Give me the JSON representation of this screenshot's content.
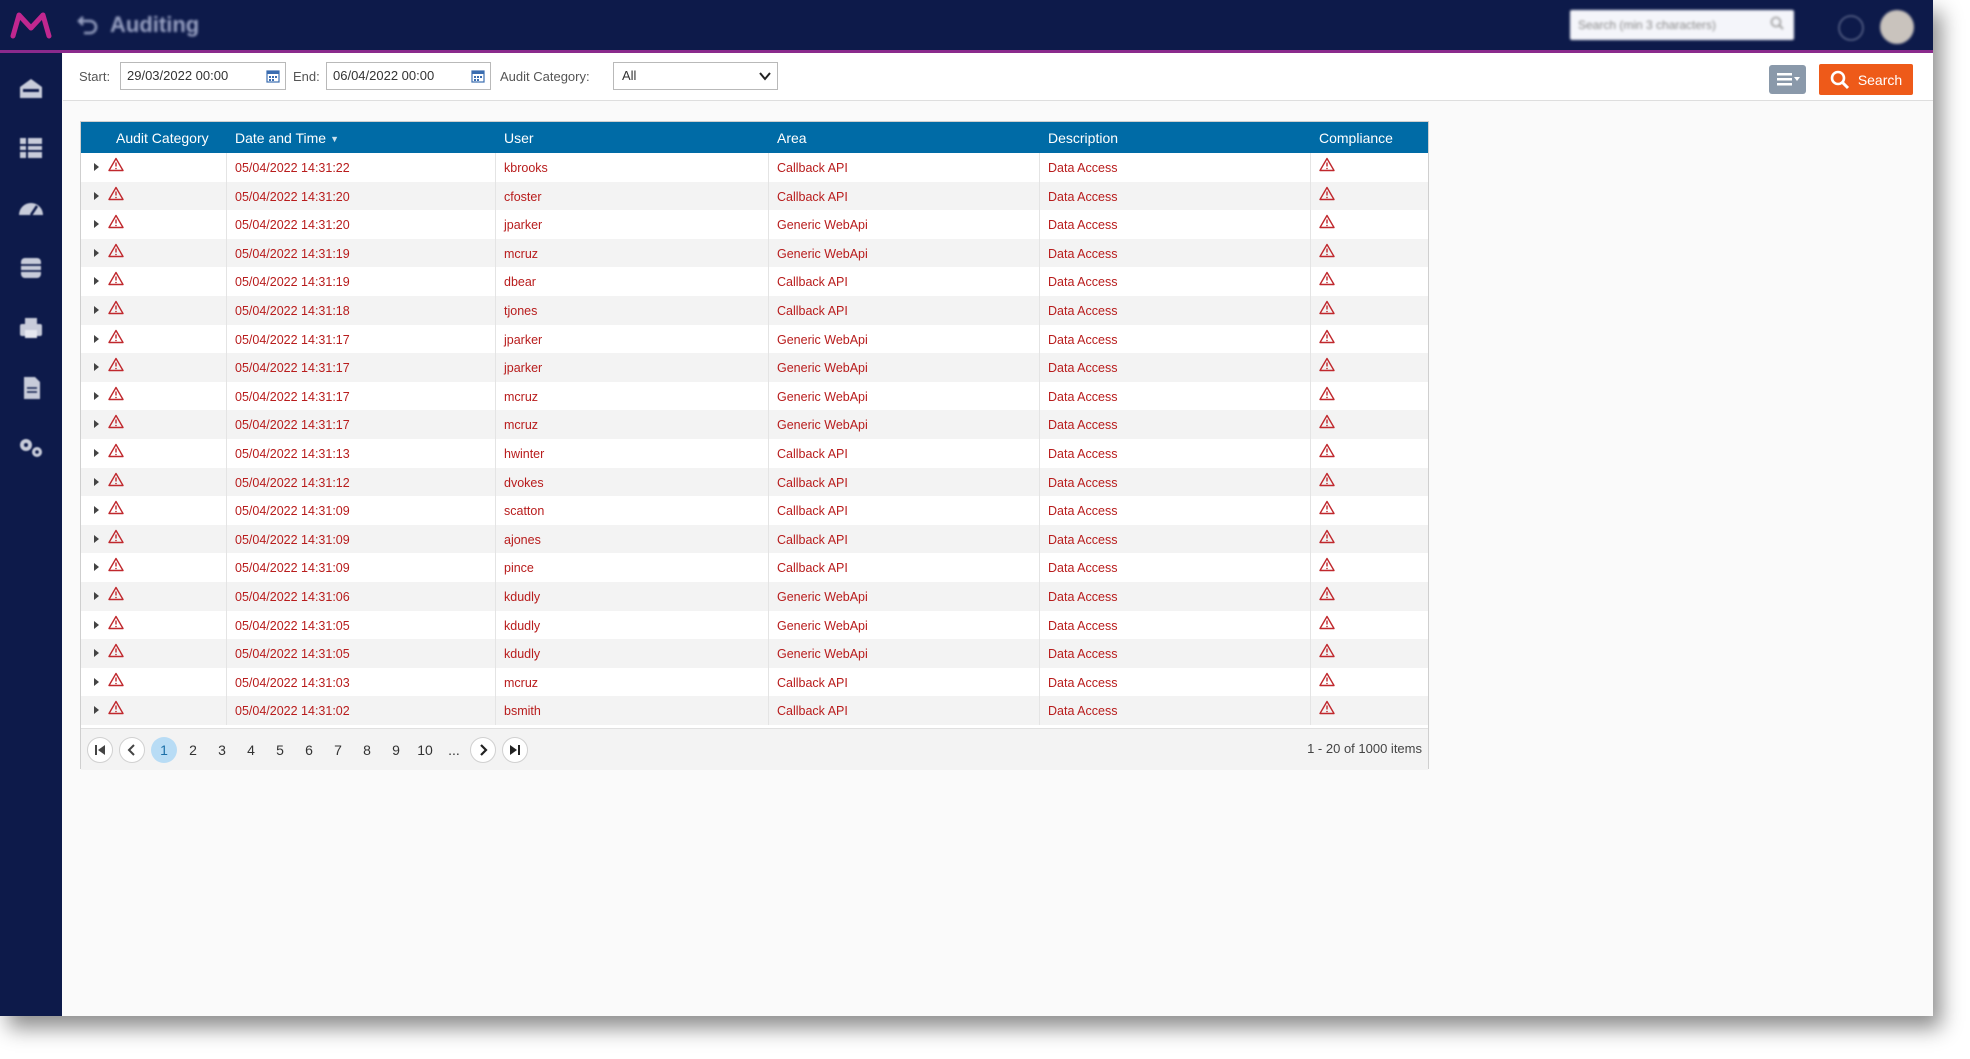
{
  "header": {
    "title": "Auditing",
    "global_search_placeholder": "Search (min 3 characters)"
  },
  "sidebar": {
    "items": [
      {
        "icon": "home-icon"
      },
      {
        "icon": "list-icon"
      },
      {
        "icon": "dashboard-icon"
      },
      {
        "icon": "database-icon"
      },
      {
        "icon": "printer-icon"
      },
      {
        "icon": "document-icon"
      },
      {
        "icon": "settings-icon"
      }
    ]
  },
  "filters": {
    "start_label": "Start:",
    "start_value": "29/03/2022 00:00",
    "end_label": "End:",
    "end_value": "06/04/2022 00:00",
    "category_label": "Audit Category:",
    "category_value": "All",
    "search_label": "Search"
  },
  "colors": {
    "topbar": "#0d1a4a",
    "accent_line": "#8a2a8c",
    "grid_header": "#006ba6",
    "row_text": "#b81c1c",
    "search_button": "#ee5a19"
  },
  "grid": {
    "columns": [
      "Audit Category",
      "Date and Time",
      "User",
      "Area",
      "Description",
      "Compliance"
    ],
    "rows": [
      {
        "datetime": "05/04/2022 14:31:22",
        "user": "kbrooks",
        "area": "Callback API",
        "description": "Data Access"
      },
      {
        "datetime": "05/04/2022 14:31:20",
        "user": "cfoster",
        "area": "Callback API",
        "description": "Data Access"
      },
      {
        "datetime": "05/04/2022 14:31:20",
        "user": "jparker",
        "area": "Generic WebApi",
        "description": "Data Access"
      },
      {
        "datetime": "05/04/2022 14:31:19",
        "user": "mcruz",
        "area": "Generic WebApi",
        "description": "Data Access"
      },
      {
        "datetime": "05/04/2022 14:31:19",
        "user": "dbear",
        "area": "Callback API",
        "description": "Data Access"
      },
      {
        "datetime": "05/04/2022 14:31:18",
        "user": "tjones",
        "area": "Callback API",
        "description": "Data Access"
      },
      {
        "datetime": "05/04/2022 14:31:17",
        "user": "jparker",
        "area": "Generic WebApi",
        "description": "Data Access"
      },
      {
        "datetime": "05/04/2022 14:31:17",
        "user": "jparker",
        "area": "Generic WebApi",
        "description": "Data Access"
      },
      {
        "datetime": "05/04/2022 14:31:17",
        "user": "mcruz",
        "area": "Generic WebApi",
        "description": "Data Access"
      },
      {
        "datetime": "05/04/2022 14:31:17",
        "user": "mcruz",
        "area": "Generic WebApi",
        "description": "Data Access"
      },
      {
        "datetime": "05/04/2022 14:31:13",
        "user": "hwinter",
        "area": "Callback API",
        "description": "Data Access"
      },
      {
        "datetime": "05/04/2022 14:31:12",
        "user": "dvokes",
        "area": "Callback API",
        "description": "Data Access"
      },
      {
        "datetime": "05/04/2022 14:31:09",
        "user": "scatton",
        "area": "Callback API",
        "description": "Data Access"
      },
      {
        "datetime": "05/04/2022 14:31:09",
        "user": "ajones",
        "area": "Callback API",
        "description": "Data Access"
      },
      {
        "datetime": "05/04/2022 14:31:09",
        "user": "pince",
        "area": "Callback API",
        "description": "Data Access"
      },
      {
        "datetime": "05/04/2022 14:31:06",
        "user": "kdudly",
        "area": "Generic WebApi",
        "description": "Data Access"
      },
      {
        "datetime": "05/04/2022 14:31:05",
        "user": "kdudly",
        "area": "Generic WebApi",
        "description": "Data Access"
      },
      {
        "datetime": "05/04/2022 14:31:05",
        "user": "kdudly",
        "area": "Generic WebApi",
        "description": "Data Access"
      },
      {
        "datetime": "05/04/2022 14:31:03",
        "user": "mcruz",
        "area": "Callback API",
        "description": "Data Access"
      },
      {
        "datetime": "05/04/2022 14:31:02",
        "user": "bsmith",
        "area": "Callback API",
        "description": "Data Access"
      }
    ]
  },
  "pager": {
    "pages": [
      "1",
      "2",
      "3",
      "4",
      "5",
      "6",
      "7",
      "8",
      "9",
      "10",
      "..."
    ],
    "current": "1",
    "info": "1 - 20 of 1000 items"
  }
}
